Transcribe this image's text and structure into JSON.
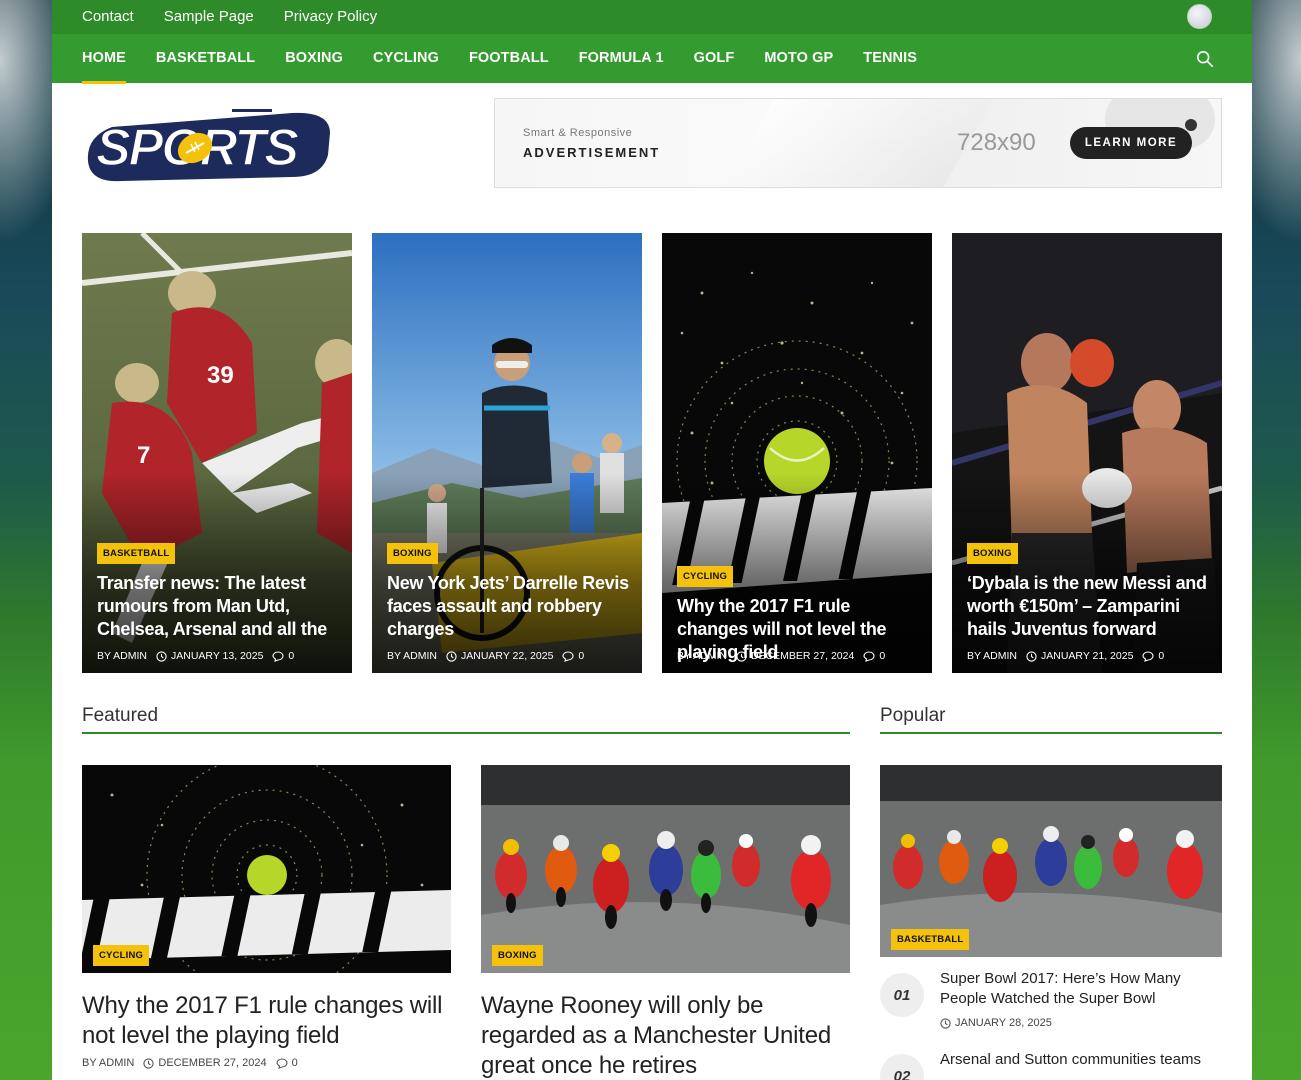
{
  "topbar": {
    "links": [
      "Contact",
      "Sample Page",
      "Privacy Policy"
    ]
  },
  "mainnav": {
    "items": [
      "HOME",
      "BASKETBALL",
      "BOXING",
      "CYCLING",
      "FOOTBALL",
      "FORMULA 1",
      "GOLF",
      "MOTO GP",
      "TENNIS"
    ],
    "active": "HOME",
    "accent_color": "#f4c20d",
    "bar_color": "#339b30"
  },
  "logo": {
    "text": "SPORTS"
  },
  "ad": {
    "tagline": "Smart & Responsive",
    "title": "ADVERTISEMENT",
    "size": "728x90",
    "button": "LEARN MORE"
  },
  "hero": [
    {
      "category": "BASKETBALL",
      "title": "Transfer news: The latest rumours from Man Utd, Chelsea, Arsenal and all the",
      "author": "BY ADMIN",
      "date": "JANUARY 13, 2025",
      "comments": "0"
    },
    {
      "category": "BOXING",
      "title": "New York Jets’ Darrelle Revis faces assault and robbery charges",
      "author": "BY ADMIN",
      "date": "JANUARY 22, 2025",
      "comments": "0"
    },
    {
      "category": "CYCLING",
      "title": "Why the 2017 F1 rule changes will not level the playing field",
      "author": "BY ADMIN",
      "date": "DECEMBER 27, 2024",
      "comments": "0"
    },
    {
      "category": "BOXING",
      "title": "‘Dybala is the new Messi and worth €150m’ – Zamparini hails Juventus forward",
      "author": "BY ADMIN",
      "date": "JANUARY 21, 2025",
      "comments": "0"
    }
  ],
  "featured": {
    "heading": "Featured",
    "cards": [
      {
        "category": "CYCLING",
        "title": "Why the 2017 F1 rule changes will not level the playing field",
        "author": "BY ADMIN",
        "date": "DECEMBER 27, 2024",
        "comments": "0"
      },
      {
        "category": "BOXING",
        "title": "Wayne Rooney will only be regarded as a Manchester United great once he retires"
      }
    ]
  },
  "popular": {
    "heading": "Popular",
    "image_category": "BASKETBALL",
    "items": [
      {
        "num": "01",
        "title": "Super Bowl 2017: Here’s How Many People Watched the Super Bowl",
        "date": "JANUARY 28, 2025"
      },
      {
        "num": "02",
        "title": "Arsenal and Sutton communities teams"
      }
    ]
  }
}
